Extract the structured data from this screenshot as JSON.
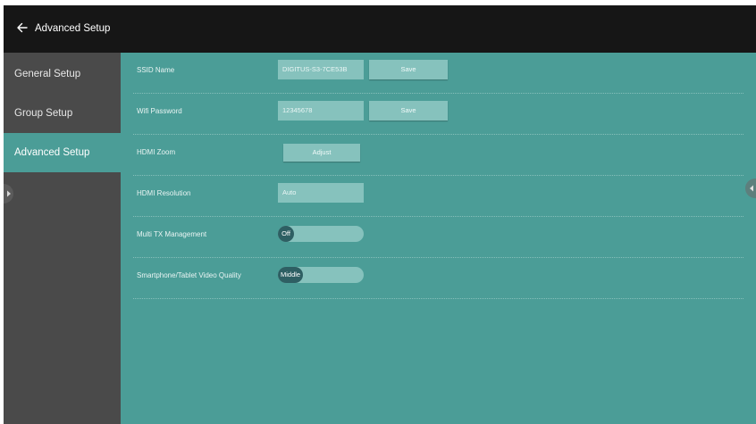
{
  "header": {
    "title": "Advanced Setup"
  },
  "sidebar": {
    "items": [
      {
        "label": "General Setup",
        "active": false
      },
      {
        "label": "Group Setup",
        "active": false
      },
      {
        "label": "Advanced Setup",
        "active": true
      }
    ]
  },
  "settings": {
    "ssid": {
      "label": "SSID Name",
      "value": "DIGITUS-S3-7CE53B",
      "button": "Save"
    },
    "wifi": {
      "label": "Wifi Password",
      "value": "12345678",
      "button": "Save"
    },
    "hdmi_zoom": {
      "label": "HDMI Zoom",
      "button": "Adjust"
    },
    "hdmi_resolution": {
      "label": "HDMI Resolution",
      "value": "Auto"
    },
    "multi_tx": {
      "label": "Multi TX Management",
      "state": "Off"
    },
    "video_quality": {
      "label": "Smartphone/Tablet Video Quality",
      "state": "Middle"
    }
  },
  "icons": {
    "back": "arrow-left-icon",
    "sidebar_toggle": "triangle-right-icon",
    "right_panel_toggle": "triangle-left-icon"
  },
  "colors": {
    "header_bg": "#161616",
    "sidebar_bg": "#4a4a4a",
    "content_bg": "#4b9d97",
    "field_bg": "#86c2bd",
    "toggle_knob": "#2e5f63"
  }
}
